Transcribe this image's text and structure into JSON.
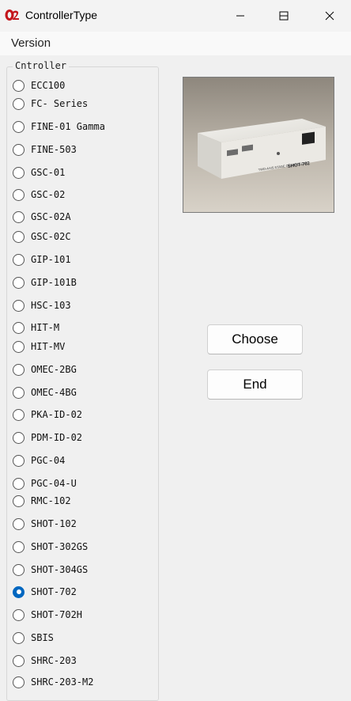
{
  "window": {
    "title": "ControllerType",
    "app_icon": "app-logo-icon",
    "controls": [
      "minimize-icon",
      "maximize-icon",
      "close-icon"
    ]
  },
  "menu": {
    "items": [
      "Version"
    ]
  },
  "controller_group": {
    "label": "Cntroller",
    "selected": "SHOT-702",
    "options": [
      "ECC100",
      "FC- Series",
      "FINE-01 Gamma",
      "FINE-503",
      "GSC-01",
      "GSC-02",
      "GSC-02A",
      "GSC-02C",
      "GIP-101",
      "GIP-101B",
      "HSC-103",
      "HIT-M",
      "HIT-MV",
      "OMEC-2BG",
      "OMEC-4BG",
      "PKA-ID-02",
      "PDM-ID-02",
      "PGC-04",
      "PGC-04-U",
      "RMC-102",
      "SHOT-102",
      "SHOT-302GS",
      "SHOT-304GS",
      "SHOT-702",
      "SHOT-702H",
      "SBIS",
      "SHRC-203",
      "SHRC-203-M2"
    ]
  },
  "preview": {
    "device_label": "SHOT-702",
    "device_sublabel": "TWO-AXIS STAGE CONTROLLER"
  },
  "buttons": {
    "choose": "Choose",
    "end": "End"
  },
  "colors": {
    "accent": "#0067c0",
    "logo_red": "#c4161c"
  }
}
